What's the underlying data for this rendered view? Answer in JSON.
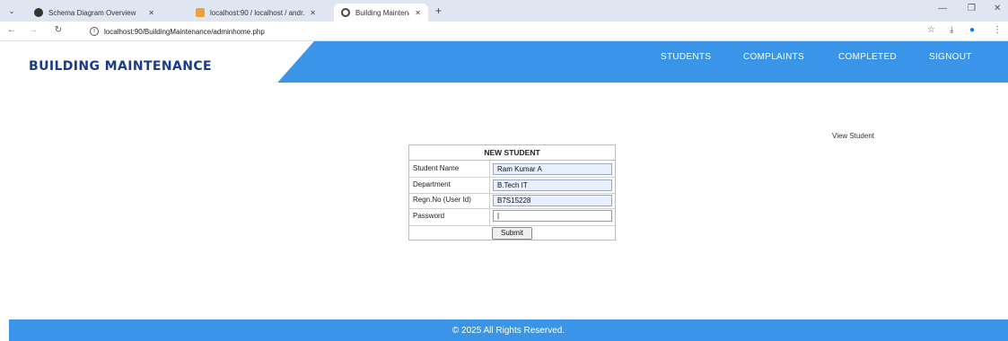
{
  "browser": {
    "tabs": [
      {
        "title": "Schema Diagram Overview",
        "active": false
      },
      {
        "title": "localhost:90 / localhost / andr...",
        "active": false
      },
      {
        "title": "Building Maintenance",
        "active": true
      }
    ],
    "url": "localhost:90/BuildingMaintenance/adminhome.php",
    "tab_dropdown_glyph": "⌄",
    "new_tab_glyph": "+",
    "close_glyph": "✕",
    "minimize_glyph": "—",
    "restore_glyph": "❐",
    "back_glyph": "←",
    "forward_glyph": "→",
    "reload_glyph": "↻",
    "info_glyph": "i",
    "star_glyph": "☆",
    "download_glyph": "⤓",
    "profile_glyph": "●",
    "menu_glyph": "⋮"
  },
  "app": {
    "brand": "BUILDING MAINTENANCE",
    "nav": [
      {
        "label": "STUDENTS"
      },
      {
        "label": "COMPLAINTS"
      },
      {
        "label": "COMPLETED"
      },
      {
        "label": "SIGNOUT"
      }
    ],
    "colors": {
      "header": "#3a95e8",
      "brand": "#1a3a8a"
    }
  },
  "main": {
    "view_link": "View Student",
    "form": {
      "title": "NEW STUDENT",
      "rows": [
        {
          "label": "Student Name",
          "value": "Ram Kumar A"
        },
        {
          "label": "Department",
          "value": "B.Tech IT"
        },
        {
          "label": "Regn.No (User Id)",
          "value": "B7S15228"
        },
        {
          "label": "Password",
          "value": "|"
        }
      ],
      "submit_label": "Submit"
    }
  },
  "footer": {
    "text": "© 2025 All Rights Reserved."
  }
}
